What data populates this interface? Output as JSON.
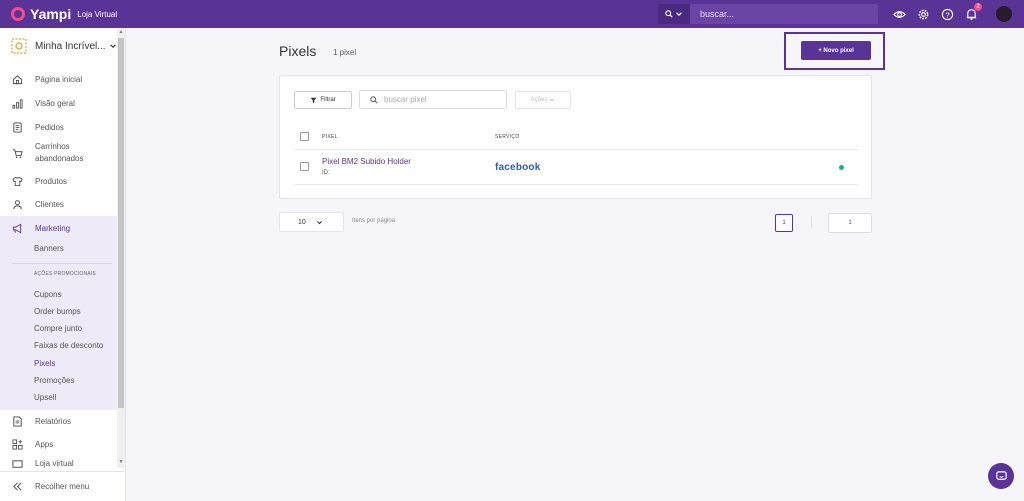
{
  "topbar": {
    "brand": "Yampi",
    "brand_sub": "Loja Virtual",
    "search_type": "Q",
    "search_placeholder": "buscar...",
    "notification_count": "2",
    "icons": [
      "eye-icon",
      "gear-icon",
      "help-icon",
      "bell-icon"
    ]
  },
  "sidebar": {
    "store_name": "Minha Incrível...",
    "items": [
      {
        "label": "Página inicial",
        "icon": "home-icon"
      },
      {
        "label": "Visão geral",
        "icon": "bar-chart-icon"
      },
      {
        "label": "Pedidos",
        "icon": "document-icon"
      },
      {
        "label": "Carrinhos abandonados",
        "icon": "cart-icon"
      },
      {
        "label": "Produtos",
        "icon": "shirt-icon"
      },
      {
        "label": "Clientes",
        "icon": "user-icon"
      },
      {
        "label": "Marketing",
        "icon": "megaphone-icon"
      },
      {
        "label": "Relatórios",
        "icon": "report-icon"
      },
      {
        "label": "Apps",
        "icon": "apps-icon"
      },
      {
        "label": "Loja virtual",
        "icon": "store-icon"
      }
    ],
    "marketing_sub": {
      "banners": "Banners",
      "section_label": "AÇÕES PROMOCIONAIS",
      "items": [
        "Cupons",
        "Order bumps",
        "Compre junto",
        "Faixas de desconto",
        "Pixels",
        "Promoções",
        "Upsell"
      ]
    },
    "collapse_label": "Recolher menu"
  },
  "main": {
    "title": "Pixels",
    "count": "1 pixel",
    "new_button": "+ Novo pixel",
    "filter_label": "Filtrar",
    "search_placeholder": "buscar pixel",
    "actions_label": "Ações",
    "columns": {
      "pixel": "PIXEL",
      "service": "SERVIÇO"
    },
    "rows": [
      {
        "name": "Pixel BM2 Subido Holder",
        "id": "ID:",
        "service": "facebook",
        "status_color": "#18b58a"
      }
    ],
    "pagination": {
      "per_page": "10",
      "per_page_label": "Itens por página",
      "current_page": "1",
      "page_input": "1"
    }
  },
  "colors": {
    "primary": "#5a3396",
    "accent": "#f04e8a",
    "success": "#18b58a",
    "facebook": "#2d5ab4"
  }
}
